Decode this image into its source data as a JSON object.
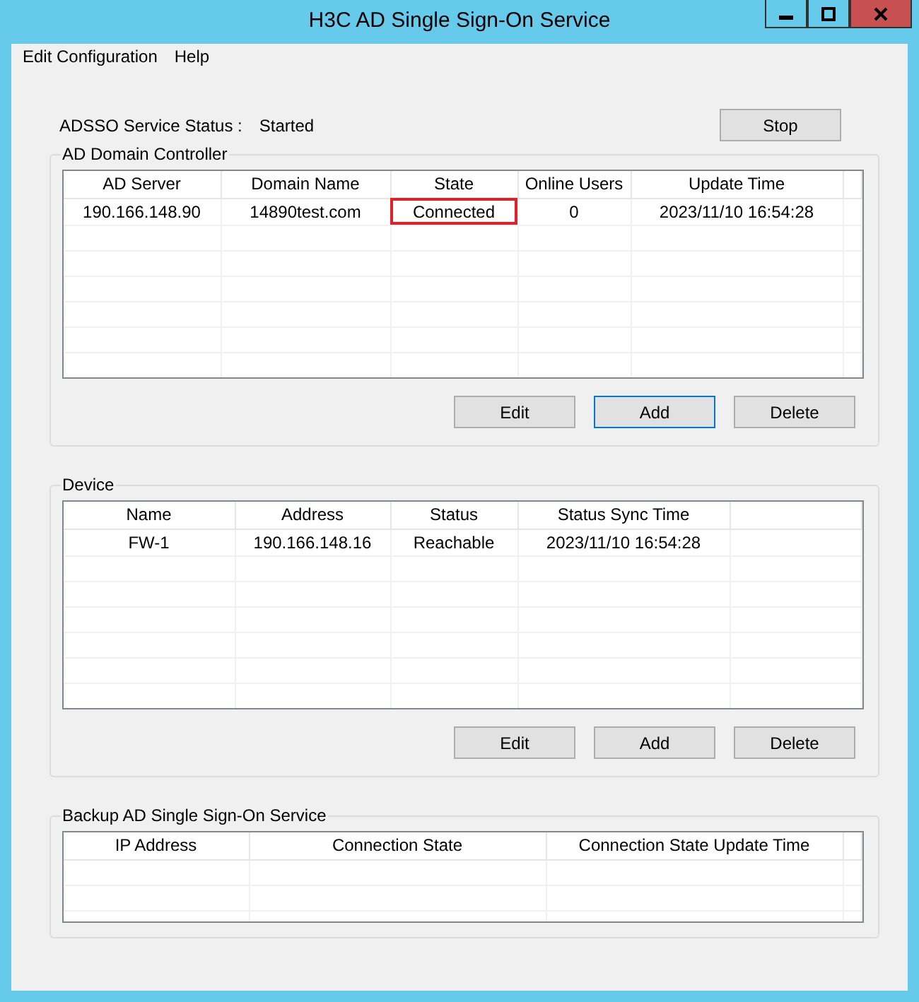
{
  "window": {
    "title": "H3C AD Single Sign-On Service"
  },
  "menu": [
    "Edit Configuration",
    "Help"
  ],
  "service_status": {
    "label": "ADSSO Service Status :",
    "value": "Started",
    "button": "Stop"
  },
  "ad_domain_controller": {
    "title": "AD Domain Controller",
    "columns": [
      "AD Server",
      "Domain Name",
      "State",
      "Online Users",
      "Update Time"
    ],
    "rows": [
      [
        {
          "text": "190.166.148.90",
          "highlighted": false
        },
        {
          "text": "14890test.com",
          "highlighted": false
        },
        {
          "text": "Connected",
          "highlighted": true
        },
        {
          "text": "0",
          "highlighted": false
        },
        {
          "text": "2023/11/10 16:54:28",
          "highlighted": false
        }
      ]
    ],
    "buttons": [
      {
        "label": "Edit",
        "focused": false
      },
      {
        "label": "Add",
        "focused": true
      },
      {
        "label": "Delete",
        "focused": false
      }
    ]
  },
  "device": {
    "title": "Device",
    "columns": [
      "Name",
      "Address",
      "Status",
      "Status Sync Time"
    ],
    "rows": [
      [
        "FW-1",
        "190.166.148.16",
        "Reachable",
        "2023/11/10 16:54:28"
      ]
    ],
    "buttons": [
      {
        "label": "Edit",
        "focused": false
      },
      {
        "label": "Add",
        "focused": false
      },
      {
        "label": "Delete",
        "focused": false
      }
    ]
  },
  "backup_service": {
    "title": "Backup AD Single Sign-On Service",
    "columns": [
      "IP Address",
      "Connection State",
      "Connection State Update Time"
    ]
  }
}
